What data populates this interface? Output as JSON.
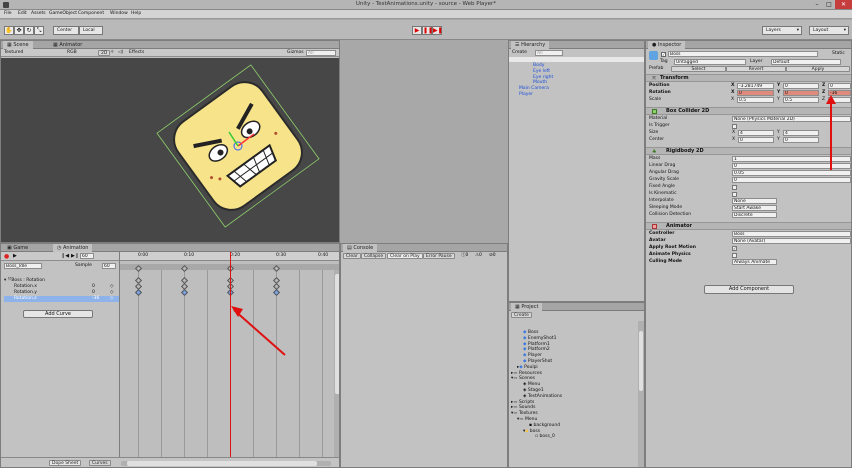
{
  "window": {
    "title": "Unity - TestAnimations.unity - source - Web Player*",
    "icon": "unity-icon"
  },
  "menu": [
    "File",
    "Edit",
    "Assets",
    "GameObject",
    "Component",
    "Window",
    "Help"
  ],
  "toolbar": {
    "pivot": "Center",
    "space": "Local",
    "layers": "Layers",
    "layout": "Layout"
  },
  "scene": {
    "tabs": [
      "Scene",
      "Animator"
    ],
    "render_mode": "Textured",
    "color_mode": "RGB",
    "mode_2d": "2D",
    "effects": "Effects",
    "gizmos": "Gizmos",
    "search_placeholder": "All"
  },
  "hierarchy": {
    "tab": "Hierarchy",
    "create": "Create",
    "search_placeholder": "All",
    "items": [
      "Body",
      "Eye left",
      "Eye right",
      "Mouth",
      "Main Camera",
      "Player"
    ]
  },
  "inspector": {
    "tab": "Inspector",
    "name": "Boss",
    "static": "Static",
    "tag_label": "Tag",
    "tag": "Untagged",
    "layer_label": "Layer",
    "layer": "Default",
    "prefab_label": "Prefab",
    "select": "Select",
    "revert": "Revert",
    "apply": "Apply",
    "transform": {
      "title": "Transform",
      "position": {
        "label": "Position",
        "x": "-3.281749",
        "y": "0",
        "z": "0"
      },
      "rotation": {
        "label": "Rotation",
        "x": "0",
        "y": "0",
        "z": "-36"
      },
      "scale": {
        "label": "Scale",
        "x": "0.5",
        "y": "0.5",
        "z": "1"
      }
    },
    "box_collider": {
      "title": "Box Collider 2D",
      "material_label": "Material",
      "material": "None (Physics Material 2D)",
      "is_trigger": "Is Trigger",
      "size_label": "Size",
      "size_x": "4",
      "size_y": "4",
      "center_label": "Center",
      "center_x": "0",
      "center_y": "0"
    },
    "rigidbody": {
      "title": "Rigidbody 2D",
      "mass_label": "Mass",
      "mass": "1",
      "linear_drag_label": "Linear Drag",
      "linear_drag": "0",
      "angular_drag_label": "Angular Drag",
      "angular_drag": "0.05",
      "gravity_label": "Gravity Scale",
      "gravity": "0",
      "fixed_angle": "Fixed Angle",
      "is_kinematic": "Is Kinematic",
      "interpolate_label": "Interpolate",
      "interpolate": "None",
      "sleeping_label": "Sleeping Mode",
      "sleeping": "Start Awake",
      "collision_label": "Collision Detection",
      "collision": "Discrete"
    },
    "animator": {
      "title": "Animator",
      "controller_label": "Controller",
      "controller": "Boss",
      "avatar_label": "Avatar",
      "avatar": "None (Avatar)",
      "root_motion": "Apply Root Motion",
      "physics": "Animate Physics",
      "culling_label": "Culling Mode",
      "culling": "Always Animate"
    },
    "add_component": "Add Component"
  },
  "animation": {
    "tabs": [
      "Game",
      "Animation"
    ],
    "clip": "Boss_Idle",
    "frame": "60",
    "sample_label": "Sample",
    "sample": "60",
    "root": "Boss : Rotation",
    "props": [
      {
        "name": "Rotation.x",
        "value": "0"
      },
      {
        "name": "Rotation.y",
        "value": "0"
      },
      {
        "name": "Rotation.z",
        "value": "-36"
      }
    ],
    "add_curve": "Add Curve",
    "ruler": [
      "0:00",
      "0:10",
      "0:20",
      "0:30",
      "0:40",
      "0:50"
    ],
    "dope_sheet": "Dope Sheet",
    "curves": "Curves"
  },
  "console": {
    "tab": "Console",
    "buttons": [
      "Clear",
      "Collapse",
      "Clear on Play",
      "Error Pause"
    ],
    "counts": [
      "0",
      "0",
      "0"
    ]
  },
  "project": {
    "tab": "Project",
    "create": "Create",
    "items": [
      {
        "label": "Boss",
        "depth": 1
      },
      {
        "label": "EnemyShot1",
        "depth": 1
      },
      {
        "label": "Platform1",
        "depth": 1
      },
      {
        "label": "Platform2",
        "depth": 1
      },
      {
        "label": "Player",
        "depth": 1
      },
      {
        "label": "PlayerShot",
        "depth": 1
      },
      {
        "label": "Poulpi",
        "depth": 1
      },
      {
        "label": "Resources",
        "depth": 0
      },
      {
        "label": "Scenes",
        "depth": 0
      },
      {
        "label": "Menu",
        "depth": 1
      },
      {
        "label": "Stage1",
        "depth": 1
      },
      {
        "label": "TestAnimations",
        "depth": 1
      },
      {
        "label": "Scripts",
        "depth": 0
      },
      {
        "label": "Sounds",
        "depth": 0
      },
      {
        "label": "Textures",
        "depth": 0
      },
      {
        "label": "Menu",
        "depth": 1
      },
      {
        "label": "background",
        "depth": 2
      },
      {
        "label": "boss",
        "depth": 1
      },
      {
        "label": "boss_0",
        "depth": 2
      }
    ]
  },
  "colors": {
    "accent": "#3b78e0",
    "red_arrow": "#e01010",
    "boss_face": "#f7e38a",
    "scene_bg": "#474747"
  }
}
